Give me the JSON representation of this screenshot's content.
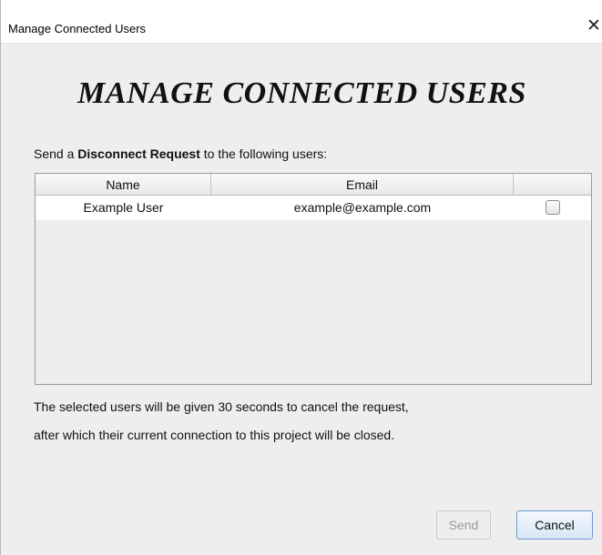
{
  "window": {
    "title": "Manage Connected Users"
  },
  "heading": "MANAGE CONNECTED USERS",
  "intro": {
    "prefix": "Send a ",
    "bold": "Disconnect Request",
    "suffix": " to the following users:"
  },
  "table": {
    "columns": [
      "Name",
      "Email",
      ""
    ],
    "rows": [
      {
        "name": "Example User",
        "email": "example@example.com",
        "checked": false
      }
    ]
  },
  "note": {
    "line1": "The selected users will be given 30 seconds to cancel the request,",
    "line2": "after which their current connection to this project will be closed."
  },
  "buttons": {
    "send": "Send",
    "cancel": "Cancel"
  }
}
